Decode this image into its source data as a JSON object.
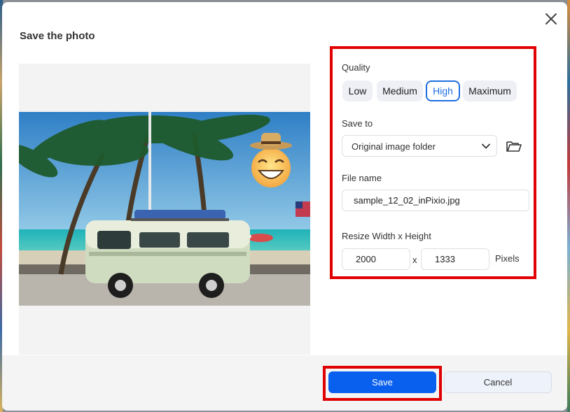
{
  "dialog": {
    "title": "Save the photo"
  },
  "preview": {
    "image_name": "beach-van-photo"
  },
  "quality": {
    "label": "Quality",
    "options": [
      "Low",
      "Medium",
      "High",
      "Maximum"
    ],
    "selected": "High"
  },
  "save_to": {
    "label": "Save to",
    "value": "Original image folder"
  },
  "file_name": {
    "label": "File name",
    "value": "sample_12_02_inPixio.jpg"
  },
  "resize": {
    "label": "Resize Width x Height",
    "width": "2000",
    "separator": "x",
    "height": "1333",
    "unit": "Pixels"
  },
  "footer": {
    "save_label": "Save",
    "cancel_label": "Cancel"
  },
  "colors": {
    "accent": "#1f6fe0",
    "primary_button": "#0a60ee",
    "highlight": "#e00000"
  }
}
